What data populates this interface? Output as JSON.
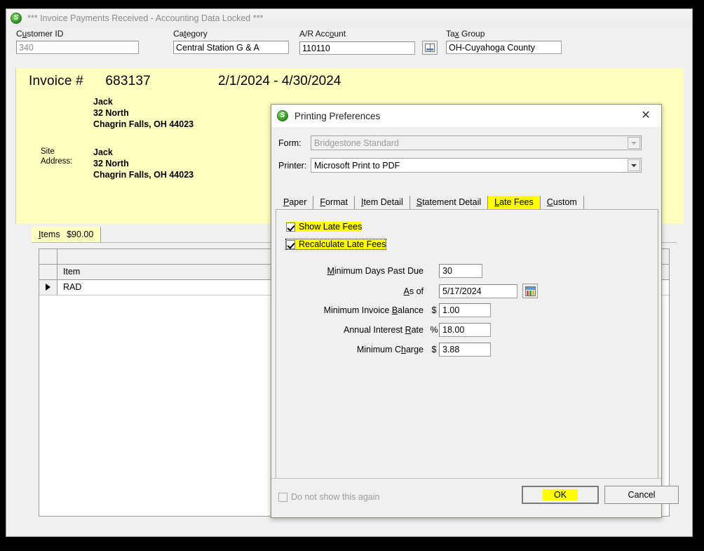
{
  "main_window": {
    "title": "*** Invoice Payments Received -  Accounting Data Locked ***",
    "app_icon": "green-s-icon",
    "fields": [
      {
        "label_pre": "C",
        "label_key": "u",
        "label_post": "stomer ID",
        "label": "Customer ID",
        "value": "340",
        "disabled": true
      },
      {
        "label": "Category",
        "value": "Central Station G & A",
        "disabled": false
      },
      {
        "label": "A/R Account",
        "value": "110110",
        "disabled": false
      },
      {
        "label": "Tax Group",
        "value": "OH-Cuyahoga County",
        "disabled": false
      }
    ],
    "ar_lookup_button": "ledger-lookup",
    "invoice": {
      "invoice_label": "Invoice #",
      "invoice_number": "683137",
      "date_range": "2/1/2024 - 4/30/2024",
      "bill_to": {
        "name": "Jack",
        "street": "32 North",
        "citystatezip": "Chagrin Falls, OH  44023"
      },
      "site_address_label_1": "Site",
      "site_address_label_2": "Address:",
      "site_to": {
        "name": "Jack",
        "street": "32 North",
        "citystatezip": "Chagrin Falls, OH  44023"
      }
    },
    "items_tab": {
      "label": "Items",
      "amount": "$90.00"
    },
    "grid": {
      "columns": [
        "Item"
      ],
      "rows": [
        {
          "selected": true,
          "item": "RAD"
        }
      ]
    }
  },
  "dialog": {
    "title": "Printing Preferences",
    "icon": "green-s-icon",
    "close_label": "✕",
    "form": {
      "label": "Form:",
      "value": "Bridgestone Standard",
      "disabled": true
    },
    "printer": {
      "label": "Printer:",
      "value": "Microsoft Print to PDF",
      "disabled": false
    },
    "tabs": [
      {
        "label": "Paper",
        "accel": "P",
        "rest": "aper",
        "active": false,
        "highlighted": false
      },
      {
        "label": "Format",
        "accel": "F",
        "rest": "ormat",
        "active": false,
        "highlighted": false
      },
      {
        "label": "Item Detail",
        "accel": "I",
        "rest": "tem Detail",
        "active": false,
        "highlighted": false
      },
      {
        "label": "Statement Detail",
        "accel": "S",
        "rest": "tatement Detail",
        "active": false,
        "highlighted": false
      },
      {
        "label": "Late Fees",
        "accel": "L",
        "rest": "ate Fees",
        "active": true,
        "highlighted": true
      },
      {
        "label": "Custom",
        "accel": "C",
        "rest": "ustom",
        "active": false,
        "highlighted": false
      }
    ],
    "late_fees": {
      "show_late_fees": {
        "label": "Show Late Fees",
        "checked": true,
        "highlighted": true
      },
      "recalculate_late_fees": {
        "label": "Recalculate Late Fees",
        "checked": true,
        "highlighted": true,
        "focused": true
      },
      "rows": [
        {
          "label_pre": "M",
          "label_rest": "inimum Days Past Due",
          "symbol": "",
          "value": "30"
        },
        {
          "label_pre": "A",
          "label_rest": "s of",
          "symbol": "",
          "value": "5/17/2024",
          "has_calendar": true
        },
        {
          "label_pre": "",
          "label_rest": "Minimum Invoice Balance",
          "symbol": "$",
          "value": "1.00"
        },
        {
          "label_pre": "",
          "label_rest": "Annual Interest Rate",
          "symbol": "%",
          "value": "18.00"
        },
        {
          "label_pre": "",
          "label_rest": "Minimum Charge",
          "symbol": "$",
          "value": "3.88"
        }
      ],
      "calendar_button": "calendar-icon"
    },
    "footer": {
      "do_not_show": {
        "label": "Do not show this again",
        "checked": false,
        "disabled": true
      },
      "ok": {
        "label": "OK",
        "highlighted": true,
        "default": true
      },
      "cancel": {
        "label": "Cancel"
      }
    }
  },
  "colors": {
    "highlight": "#ffff00",
    "invoice_panel": "#ffffbf",
    "window_face": "#f0f0f0",
    "accent_icon_green": "#3fa22c"
  }
}
